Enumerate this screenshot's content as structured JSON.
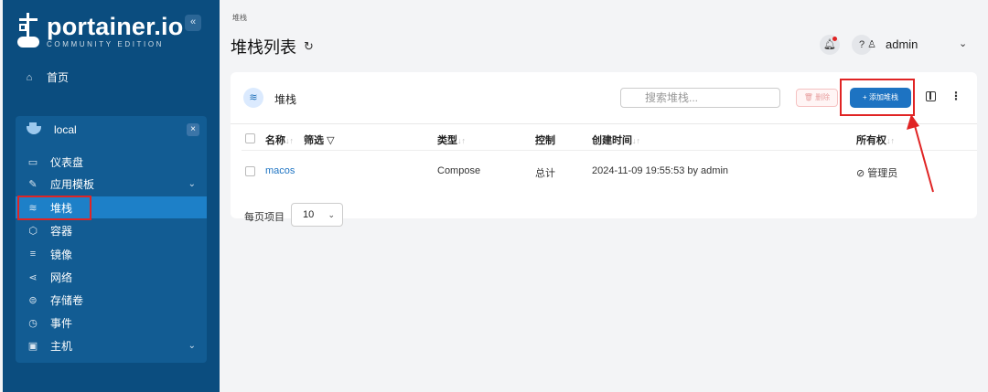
{
  "sidebar": {
    "brand": "portainer.io",
    "edition": "COMMUNITY EDITION",
    "collapse_label": "«",
    "home_label": "首页",
    "environment": {
      "name": "local",
      "close_label": "×",
      "items": [
        {
          "label": "仪表盘",
          "icon": "dashboard-icon",
          "glyph": "▭"
        },
        {
          "label": "应用模板",
          "icon": "edit-icon",
          "glyph": "✎",
          "chevron": "⌄"
        },
        {
          "label": "堆栈",
          "icon": "layers-icon",
          "glyph": "≋",
          "active": true
        },
        {
          "label": "容器",
          "icon": "cube-icon",
          "glyph": "⬡"
        },
        {
          "label": "镜像",
          "icon": "list-icon",
          "glyph": "≡"
        },
        {
          "label": "网络",
          "icon": "share-icon",
          "glyph": "⋖"
        },
        {
          "label": "存储卷",
          "icon": "database-icon",
          "glyph": "⊜"
        },
        {
          "label": "事件",
          "icon": "clock-icon",
          "glyph": "◷"
        },
        {
          "label": "主机",
          "icon": "server-icon",
          "glyph": "▣",
          "chevron": "⌄"
        }
      ]
    }
  },
  "header": {
    "breadcrumb": "堆栈",
    "title": "堆栈列表",
    "user": "admin"
  },
  "card": {
    "title": "堆栈",
    "search_placeholder": "搜索堆栈...",
    "delete_label": "🗑 删除",
    "add_label": "+ 添加堆栈",
    "columns": {
      "name": "名称",
      "filter": "筛选",
      "type": "类型",
      "control": "控制",
      "created": "创建时间",
      "ownership": "所有权"
    },
    "rows": [
      {
        "name": "macos",
        "type": "Compose",
        "control": "总计",
        "created": "2024-11-09 19:55:53 by admin",
        "ownership": "管理员"
      }
    ]
  },
  "pagination": {
    "per_page_label": "每页项目",
    "per_page_value": "10"
  },
  "colors": {
    "sidebar_bg": "#0b4d7f",
    "primary": "#1d73c2",
    "highlight": "#e02424"
  }
}
